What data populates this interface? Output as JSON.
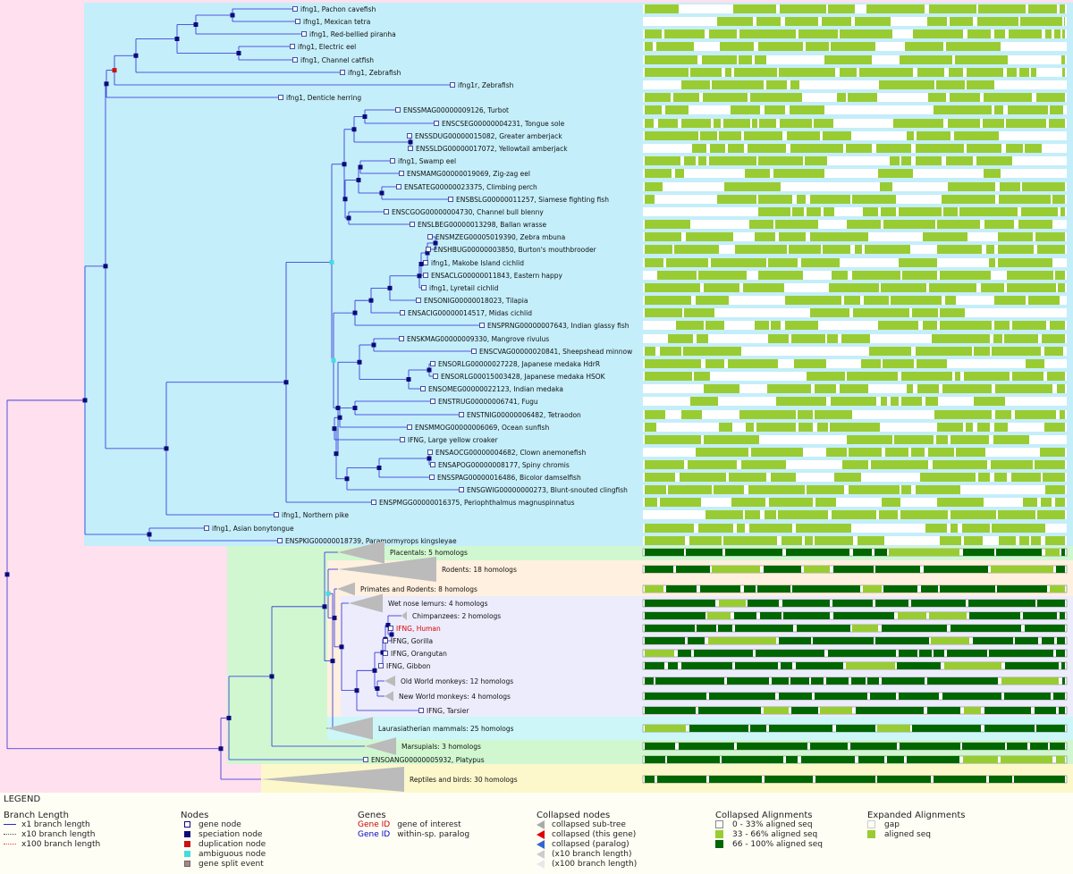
{
  "colors": {
    "root_bg": "#ffe0ee",
    "fish_bg": "#c4eefa",
    "mammal_bg": "#d0f7d0",
    "rodent_bg": "#fff0df",
    "primate_bg": "#ececfc",
    "laur_bg": "#cdf6f9",
    "reptile_bg": "#fdf8cc",
    "branch": "#2a2ad8",
    "node": "#0b0b7a",
    "dup": "#cc1111",
    "amb": "#44dddd",
    "light_green": "#99cc33",
    "dark_green": "#006600",
    "mid_green": "#99cc33",
    "collapsed": "#bbbbbb"
  },
  "tree": {
    "leaves": [
      {
        "label": "ifng1, Pachon cavefish",
        "type": "leaf"
      },
      {
        "label": "ifng1, Mexican tetra",
        "type": "leaf"
      },
      {
        "label": "ifng1, Red-bellied piranha",
        "type": "leaf"
      },
      {
        "label": "ifng1, Electric eel",
        "type": "leaf"
      },
      {
        "label": "ifng1, Channel catfish",
        "type": "leaf"
      },
      {
        "label": "ifng1, Zebrafish",
        "type": "leaf"
      },
      {
        "label": "ifng1r, Zebrafish",
        "type": "leaf"
      },
      {
        "label": "ifng1, Denticle herring",
        "type": "leaf"
      },
      {
        "label": "ENSSMAG00000009126, Turbot",
        "type": "leaf"
      },
      {
        "label": "ENSCSEG00000004231, Tongue sole",
        "type": "leaf"
      },
      {
        "label": "ENSSDUG00000015082, Greater amberjack",
        "type": "leaf"
      },
      {
        "label": "ENSSLDG00000017072, Yellowtail amberjack",
        "type": "leaf"
      },
      {
        "label": "ifng1, Swamp eel",
        "type": "leaf"
      },
      {
        "label": "ENSMAMG00000019069, Zig-zag eel",
        "type": "leaf"
      },
      {
        "label": "ENSATEG00000023375, Climbing perch",
        "type": "leaf"
      },
      {
        "label": "ENSBSLG00000011257, Siamese fighting fish",
        "type": "leaf"
      },
      {
        "label": "ENSCGOG00000004730, Channel bull blenny",
        "type": "leaf"
      },
      {
        "label": "ENSLBEG00000013298, Ballan wrasse",
        "type": "leaf"
      },
      {
        "label": "ENSMZEG00005019390, Zebra mbuna",
        "type": "leaf"
      },
      {
        "label": "ENSHBUG00000003850, Burton's mouthbrooder",
        "type": "leaf"
      },
      {
        "label": "ifng1, Makobe Island cichlid",
        "type": "leaf"
      },
      {
        "label": "ENSACLG00000011843, Eastern happy",
        "type": "leaf"
      },
      {
        "label": "ifng1, Lyretail cichlid",
        "type": "leaf"
      },
      {
        "label": "ENSONIG00000018023, Tilapia",
        "type": "leaf"
      },
      {
        "label": "ENSACIG00000014517, Midas cichlid",
        "type": "leaf"
      },
      {
        "label": "ENSPRNG00000007643, Indian glassy fish",
        "type": "leaf"
      },
      {
        "label": "ENSKMAG00000009330, Mangrove rivulus",
        "type": "leaf"
      },
      {
        "label": "ENSCVAG00000020841, Sheepshead minnow",
        "type": "leaf"
      },
      {
        "label": "ENSORLG00000027228, Japanese medaka HdrR",
        "type": "leaf"
      },
      {
        "label": "ENSORLG00015003428, Japanese medaka HSOK",
        "type": "leaf"
      },
      {
        "label": "ENSOMEG00000022123, Indian medaka",
        "type": "leaf"
      },
      {
        "label": "ENSTRUG00000006741, Fugu",
        "type": "leaf"
      },
      {
        "label": "ENSTNIG00000006482, Tetraodon",
        "type": "leaf"
      },
      {
        "label": "ENSMMOG00000006069, Ocean sunfish",
        "type": "leaf"
      },
      {
        "label": "IFNG, Large yellow croaker",
        "type": "leaf"
      },
      {
        "label": "ENSAOCG00000004682, Clown anemonefish",
        "type": "leaf"
      },
      {
        "label": "ENSAPOG00000008177, Spiny chromis",
        "type": "leaf"
      },
      {
        "label": "ENSSPAG00000016486, Bicolor damselfish",
        "type": "leaf"
      },
      {
        "label": "ENSGWIG00000000273, Blunt-snouted clingfish",
        "type": "leaf"
      },
      {
        "label": "ENSPMGG00000016375, Periophthalmus magnuspinnatus",
        "type": "leaf"
      },
      {
        "label": "ifng1, Northern pike",
        "type": "leaf"
      },
      {
        "label": "ifng1, Asian bonytongue",
        "type": "leaf"
      },
      {
        "label": "ENSPKIG00000018739, Paramormyrops kingsleyae",
        "type": "leaf"
      },
      {
        "label": "Placentals: 5 homologs",
        "type": "collapsed"
      },
      {
        "label": "Rodents: 18 homologs",
        "type": "collapsed"
      },
      {
        "label": "Primates and Rodents: 8 homologs",
        "type": "collapsed"
      },
      {
        "label": "Wet nose lemurs: 4 homologs",
        "type": "collapsed"
      },
      {
        "label": "Chimpanzees: 2 homologs",
        "type": "collapsed"
      },
      {
        "label": "IFNG, Human",
        "type": "interest"
      },
      {
        "label": "IFNG, Gorilla",
        "type": "leaf"
      },
      {
        "label": "IFNG, Orangutan",
        "type": "leaf"
      },
      {
        "label": "IFNG, Gibbon",
        "type": "leaf"
      },
      {
        "label": "Old World monkeys: 12 homologs",
        "type": "collapsed"
      },
      {
        "label": "New World monkeys: 4 homologs",
        "type": "collapsed"
      },
      {
        "label": "IFNG, Tarsier",
        "type": "leaf"
      },
      {
        "label": "Laurasiatherian mammals: 25 homologs",
        "type": "collapsed"
      },
      {
        "label": "Marsupials: 3 homologs",
        "type": "collapsed"
      },
      {
        "label": "ENSOANG00000005932, Platypus",
        "type": "leaf"
      },
      {
        "label": "Reptiles and birds: 30 homologs",
        "type": "collapsed"
      }
    ]
  },
  "legend": {
    "title": "LEGEND",
    "branch_length": {
      "heading": "Branch Length",
      "items": [
        "x1 branch length",
        "x10 branch length",
        "x100 branch length"
      ]
    },
    "nodes": {
      "heading": "Nodes",
      "items": [
        "gene node",
        "speciation node",
        "duplication node",
        "ambiguous node",
        "gene split event"
      ]
    },
    "genes": {
      "heading": "Genes",
      "items": [
        {
          "tag": "Gene ID",
          "text": "gene of interest",
          "color": "#cc0000"
        },
        {
          "tag": "Gene ID",
          "text": "within-sp. paralog",
          "color": "#0000cc"
        }
      ]
    },
    "collapsed_nodes": {
      "heading": "Collapsed nodes",
      "items": [
        "collapsed sub-tree",
        "collapsed (this gene)",
        "collapsed (paralog)",
        "(x10 branch length)",
        "(x100 branch length)"
      ]
    },
    "collapsed_alignments": {
      "heading": "Collapsed Alignments",
      "items": [
        "0 - 33% aligned seq",
        "33 - 66% aligned seq",
        "66 - 100% aligned seq"
      ]
    },
    "expanded_alignments": {
      "heading": "Expanded Alignments",
      "items": [
        "gap",
        "aligned seq"
      ]
    }
  }
}
